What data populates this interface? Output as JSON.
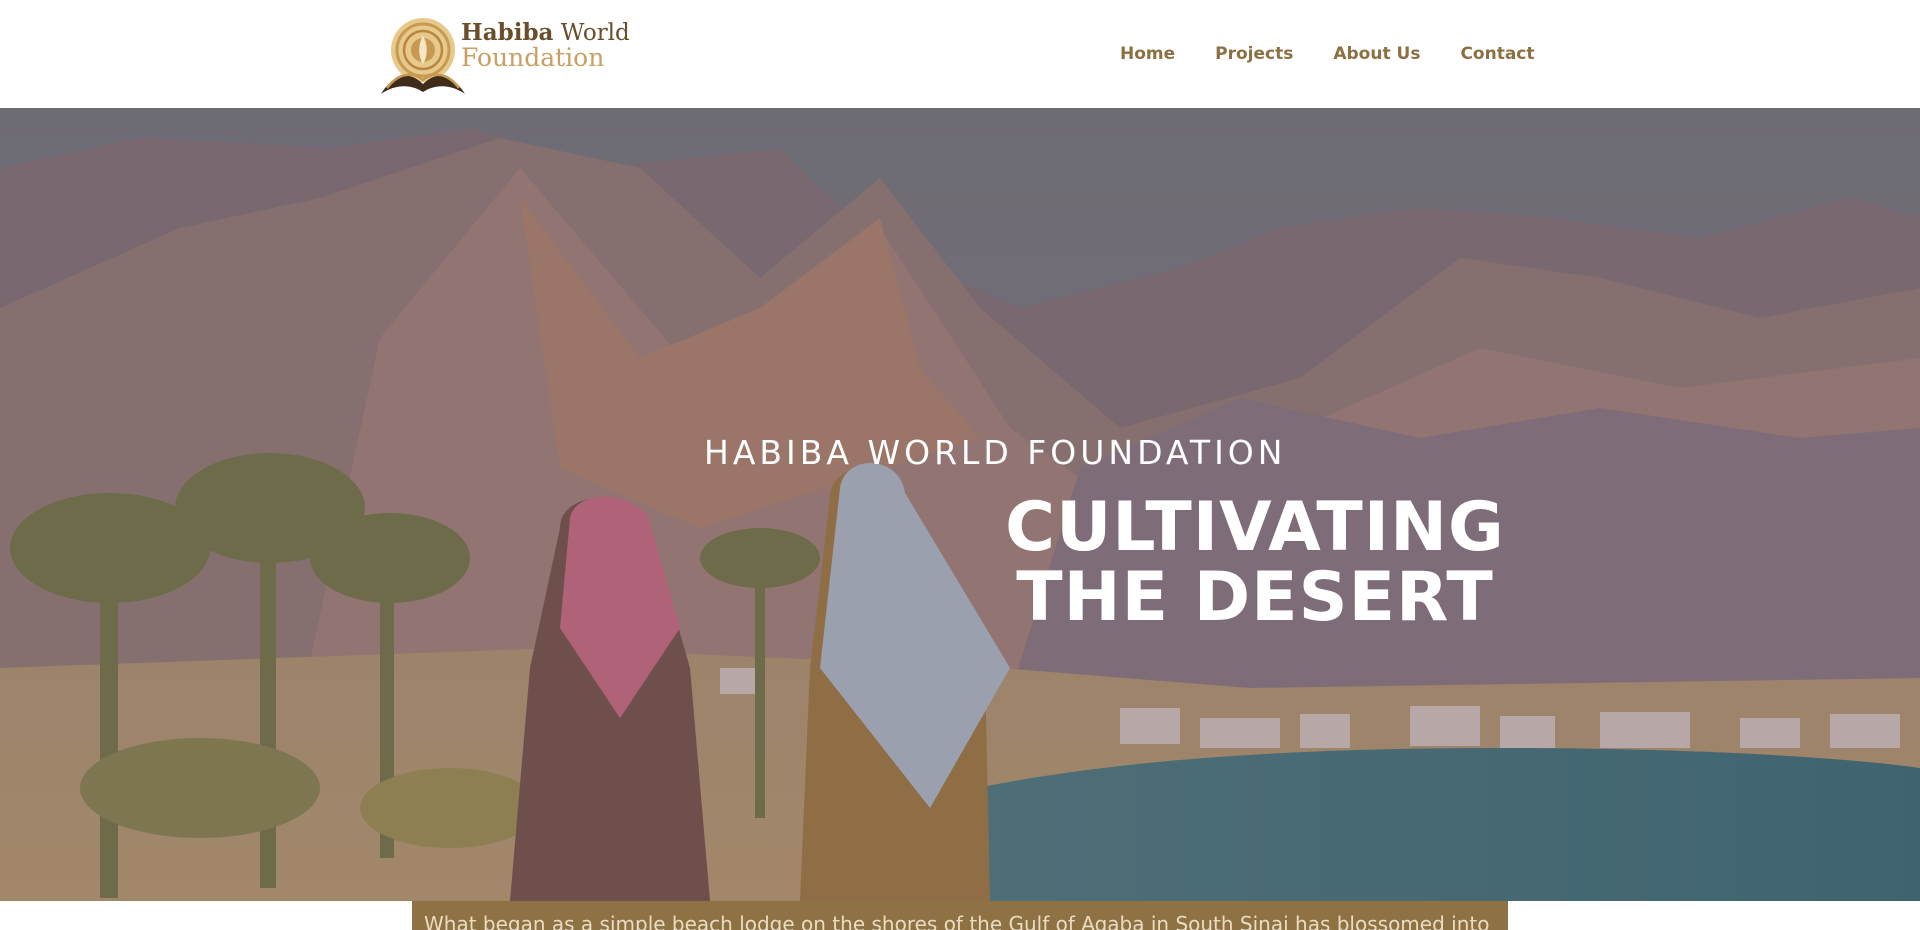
{
  "logo": {
    "line1_bold": "Habiba",
    "line1_rest": " World",
    "line2": "Foundation",
    "emblem_icon": "lotus-emblem-icon"
  },
  "nav": {
    "items": [
      {
        "label": "Home"
      },
      {
        "label": "Projects"
      },
      {
        "label": "About Us"
      },
      {
        "label": "Contact"
      }
    ]
  },
  "hero": {
    "kicker": "HABIBA WORLD FOUNDATION",
    "title_line1": "CULTIVATING",
    "title_line2": "THE DESERT"
  },
  "intro": {
    "text": "What began as a simple beach lodge on the shores of the Gulf of Aqaba in South Sinai has blossomed into"
  },
  "colors": {
    "brand_dark": "#6a4e2c",
    "brand_gold": "#c8a062",
    "nav_text": "#8c7042",
    "intro_band": "#8f7243"
  }
}
